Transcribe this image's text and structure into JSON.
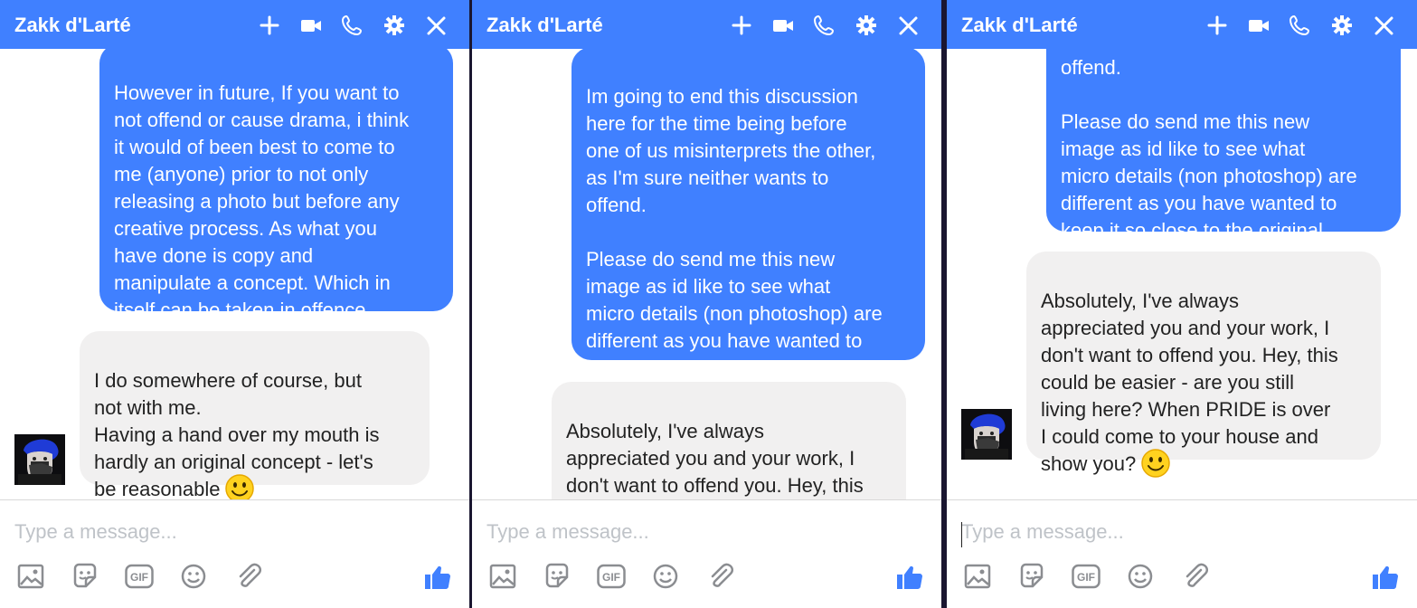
{
  "colors": {
    "accent": "#4080ff",
    "incoming_bubble": "#f1f0f0",
    "placeholder": "#bfc3c8",
    "like_blue": "#4080ff"
  },
  "header_icons": [
    "plus-icon",
    "video-camera-icon",
    "phone-icon",
    "gear-icon",
    "close-icon"
  ],
  "composer_tool_icons": [
    "image-icon",
    "sticker-icon",
    "gif-icon",
    "emoji-icon",
    "paperclip-icon"
  ],
  "panels": [
    {
      "title": "Zakk d'Larté",
      "messages": [
        {
          "direction": "outgoing",
          "text": "However in future, If you want to\nnot offend or cause drama, i think\nit would of been best to come to\nme (anyone) prior to not only\nreleasing a photo but before any\ncreative process. As what you\nhave done is copy and\nmanipulate a concept. Which in\nitself can be taken in offence."
        },
        {
          "direction": "incoming",
          "text": "I do somewhere of course, but\nnot with me.\nHaving a hand over my mouth is\nhardly an original concept - let's\nbe reasonable",
          "emoji": "smiley"
        }
      ],
      "composer": {
        "placeholder": "Type a message...",
        "gif_label": "GIF"
      }
    },
    {
      "title": "Zakk d'Larté",
      "messages": [
        {
          "direction": "outgoing",
          "text": "Im going to end this discussion\nhere for the time being before\none of us misinterprets the other,\nas I'm sure neither wants to\noffend.\n\nPlease do send me this new\nimage as id like to see what\nmicro details (non photoshop) are\ndifferent as you have wanted to\nkeep it so close to the original."
        },
        {
          "direction": "incoming",
          "text": "Absolutely, I've always\nappreciated you and your work, I\ndon't want to offend you. Hey, this\ncould be easier - are you still"
        }
      ],
      "composer": {
        "placeholder": "Type a message...",
        "gif_label": "GIF"
      }
    },
    {
      "title": "Zakk d'Larté",
      "messages": [
        {
          "direction": "outgoing",
          "text": "offend.\n\nPlease do send me this new\nimage as id like to see what\nmicro details (non photoshop) are\ndifferent as you have wanted to\nkeep it so close to the original."
        },
        {
          "direction": "incoming",
          "text": "Absolutely, I've always\nappreciated you and your work, I\ndon't want to offend you. Hey, this\ncould be easier - are you still\nliving here? When PRIDE is over\nI could come to your house and\nshow you?",
          "emoji": "smiley"
        }
      ],
      "composer": {
        "placeholder": "Type a message...",
        "gif_label": "GIF"
      }
    }
  ]
}
